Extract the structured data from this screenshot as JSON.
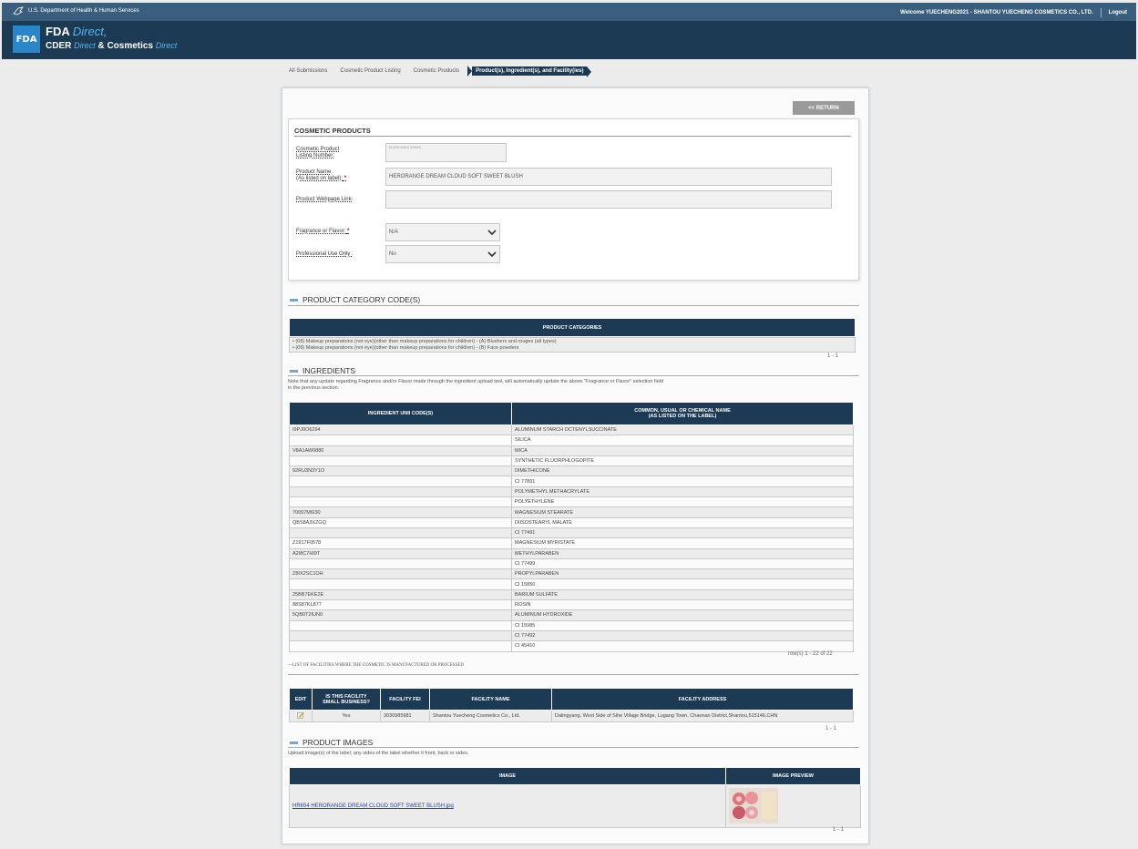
{
  "top_bar": {
    "agency": "U.S. Department of Health & Human Services",
    "welcome": "Welcome YUECHENG2021 - SHANTOU YUECHENG COSMETICS CO., LTD.",
    "logout": "Logout"
  },
  "header": {
    "logo_text": "FDA",
    "fda": "FDA",
    "direct": "Direct",
    "cder": "CDER",
    "direct2": "Direct",
    "amp": "&",
    "cosmetics": "Cosmetics",
    "direct3": "Direct"
  },
  "breadcrumb": [
    "All Submissions",
    "Cosmetic Product Listing",
    "Cosmetic Products",
    "Product(s), Ingredient(s), and Facility(ies)"
  ],
  "return_label": "<< RETURN",
  "cosmetic_products": {
    "title": "COSMETIC PRODUCTS",
    "listing_number_label_1": "Cosmetic Product",
    "listing_number_label_2": "Listing Number:",
    "listing_number_value": "CLXXX-XXXX-XXXXX",
    "product_name_label_1": "Product Name",
    "product_name_label_2": "(As listed on label):",
    "product_name_value": "HERORANGE DREAM CLOUD SOFT SWEET BLUSH",
    "webpage_label": "Product Webpage Link:",
    "webpage_value": "",
    "fragrance_label": "Fragrance or Flavor:",
    "fragrance_value": "N/A",
    "professional_label": "Professional Use Only :",
    "professional_value": "No",
    "required_mark": "*"
  },
  "category": {
    "heading": "PRODUCT CATEGORY CODE(S)",
    "column": "PRODUCT CATEGORIES",
    "items": [
      "(08) Makeup preparations (not eye)(other than makeup preparations for children) - (A) Blushers and rouges (all types)",
      "(08) Makeup preparations (not eye)(other than makeup preparations for children) - (B) Face powders"
    ],
    "count": "1 - 1"
  },
  "ingredients": {
    "heading": "INGREDIENTS",
    "note_1": "Note that any update regarding Fragrance and/or Flavor made through the ingredient upload tool, will automatically update the above \"Fragrance or Flavor\" selection field",
    "note_2": "in the previous section.",
    "col_unii": "INGREDIENT UNII CODE(S)",
    "col_name_1": "COMMON, USUAL OR CHEMICAL NAME",
    "col_name_2": "(AS LISTED ON THE LABEL)",
    "rows": [
      {
        "unii": "I9PJ0O6294",
        "name": "ALUMINUM STARCH OCTENYLSUCCINATE"
      },
      {
        "unii": "",
        "name": "SILICA"
      },
      {
        "unii": "V8A1AW0880",
        "name": "MICA"
      },
      {
        "unii": "",
        "name": "SYNTHETIC FLUORPHLOGOPITE"
      },
      {
        "unii": "92RU3N3Y1O",
        "name": "DIMETHICONE"
      },
      {
        "unii": "",
        "name": "CI 77891"
      },
      {
        "unii": "",
        "name": "POLYMETHYL METHACRYLATE"
      },
      {
        "unii": "",
        "name": "POLYETHYLENE"
      },
      {
        "unii": "70097M6I30",
        "name": "MAGNESIUM STEARATE"
      },
      {
        "unii": "QBS8A3XZGQ",
        "name": "DIISOSTEARYL MALATE"
      },
      {
        "unii": "",
        "name": "CI 77491"
      },
      {
        "unii": "Z1917F0578",
        "name": "MAGNESIUM MYRISTATE"
      },
      {
        "unii": "A2I8C7HI9T",
        "name": "METHYLPARABEN"
      },
      {
        "unii": "",
        "name": "CI 77499"
      },
      {
        "unii": "Z8IX2SC1OH",
        "name": "PROPYLPARABEN"
      },
      {
        "unii": "",
        "name": "CI 15850"
      },
      {
        "unii": "25BB7EKE2E",
        "name": "BARIUM SULFATE"
      },
      {
        "unii": "88S87KL877",
        "name": "ROSIN"
      },
      {
        "unii": "5QB0T2IUN0",
        "name": "ALUMINUM HYDROXIDE"
      },
      {
        "unii": "",
        "name": "CI 15985"
      },
      {
        "unii": "",
        "name": "CI 77492"
      },
      {
        "unii": "",
        "name": "CI 45410"
      }
    ],
    "count": "row(s) 1 - 22 of 22"
  },
  "facilities": {
    "heading": "LIST OF FACILITIES WHERE THE COSMETIC IS MANUFACTURED OR PROCESSED",
    "col_edit": "EDIT",
    "col_small_1": "IS THIS FACILITY",
    "col_small_2": "SMALL BUSINESS?",
    "col_fei": "FACILITY FEI",
    "col_name": "FACILITY NAME",
    "col_address": "FACILITY ADDRESS",
    "rows": [
      {
        "small": "Yes",
        "fei": "3030985981",
        "name": "Shantou Yuecheng Cosmetics Co., Ltd.",
        "address": "Dalingyang, West Side of Sihe Village Bridge, Lugang Town, Chaonan District,Shantou,515146,CHN"
      }
    ],
    "count": "1 - 1"
  },
  "images": {
    "heading": "PRODUCT IMAGES",
    "note": "Upload image(s) of the label; any sides of the label whether it front, back or sides.",
    "col_image": "IMAGE",
    "col_preview": "IMAGE PREVIEW",
    "file": "HR654 HERORANGE DREAM CLOUD SOFT SWEET BLUSH.jpg",
    "count": "1 - 1"
  },
  "colors": {
    "header_dark": "#1d3a55",
    "top_bar": "#3a5f7e",
    "accent_blue": "#5bb4ea",
    "required_red": "#cc0000"
  }
}
